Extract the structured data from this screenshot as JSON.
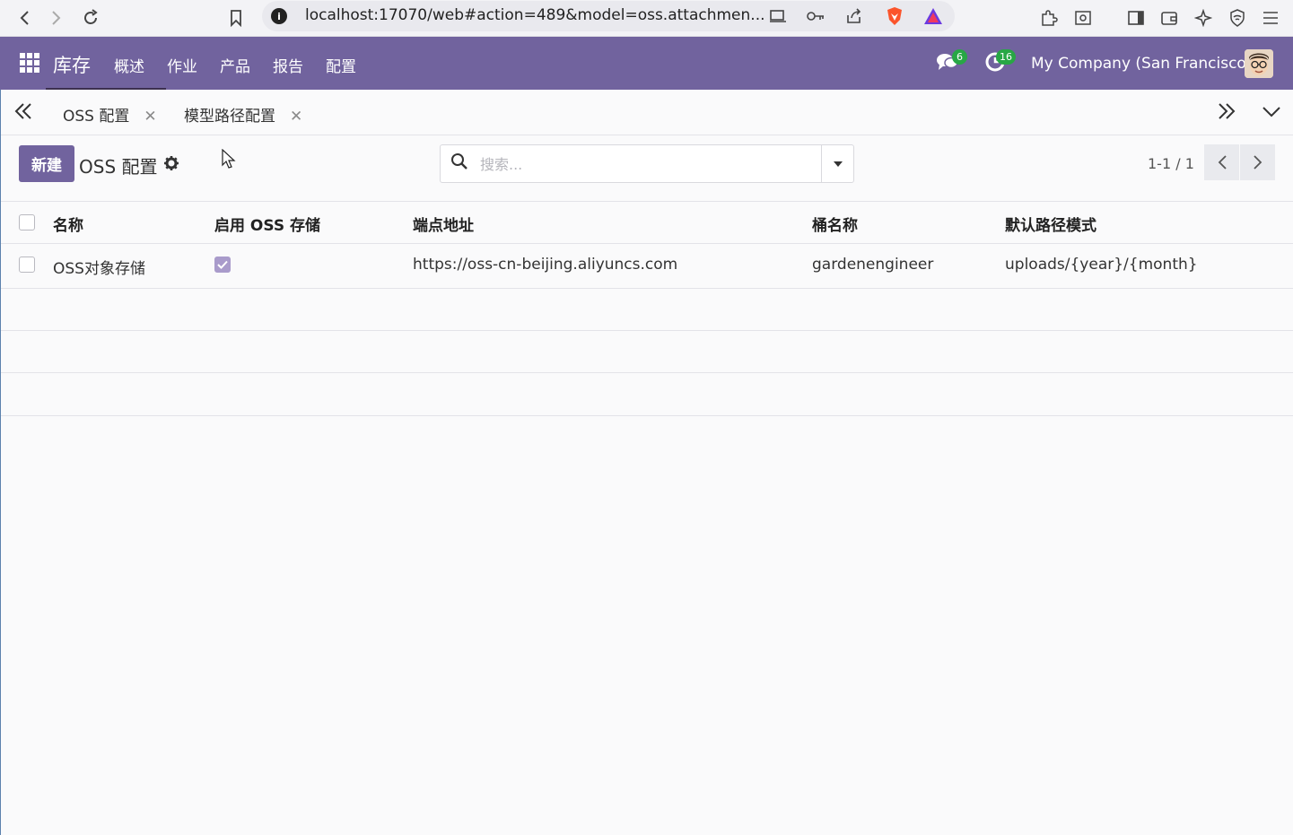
{
  "browser": {
    "url": "localhost:17070/web#action=489&model=oss.attachmen..."
  },
  "navbar": {
    "app_name": "库存",
    "menu": [
      "概述",
      "作业",
      "产品",
      "报告",
      "配置"
    ],
    "messages_badge": "6",
    "activities_badge": "16",
    "company": "My Company (San Francisco)"
  },
  "tabs": [
    {
      "label": "OSS 配置"
    },
    {
      "label": "模型路径配置"
    }
  ],
  "control_panel": {
    "new_label": "新建",
    "breadcrumb": "OSS 配置",
    "search_placeholder": "搜索...",
    "pager": "1-1 / 1"
  },
  "table": {
    "columns": [
      "名称",
      "启用 OSS 存储",
      "端点地址",
      "桶名称",
      "默认路径模式"
    ],
    "rows": [
      {
        "name": "OSS对象存储",
        "enabled": true,
        "endpoint": "https://oss-cn-beijing.aliyuncs.com",
        "bucket": "gardenengineer",
        "path_pattern": "uploads/{year}/{month}"
      }
    ]
  },
  "colors": {
    "primary": "#71639e",
    "badge": "#28a745"
  }
}
